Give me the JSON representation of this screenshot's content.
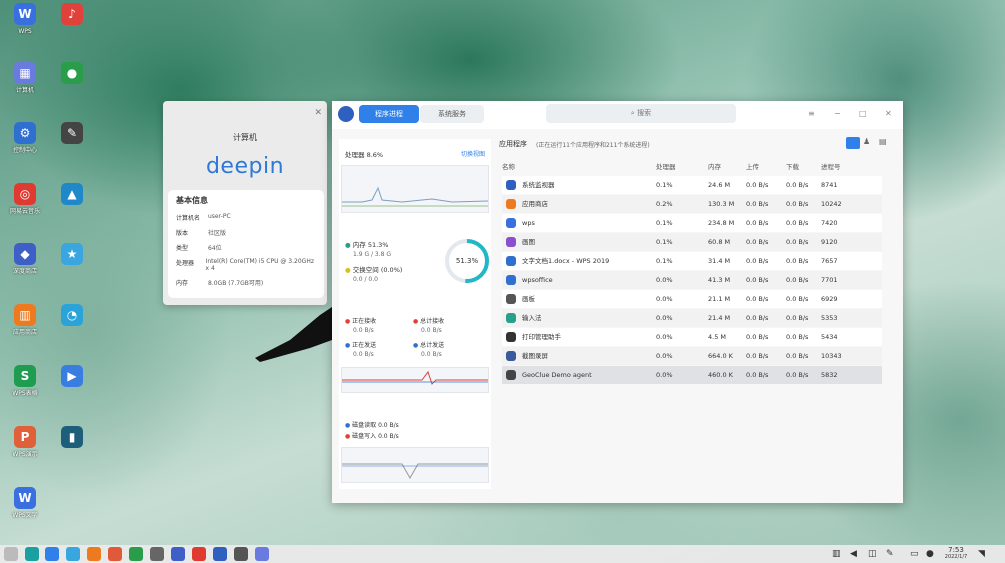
{
  "desktop": {
    "icons": [
      {
        "label": "WPS",
        "glyph": "W",
        "color": "#3a6fe0"
      },
      {
        "label": "",
        "glyph": "♪",
        "color": "#e0413a"
      },
      {
        "label": "计算机",
        "glyph": "▦",
        "color": "#6a7be0"
      },
      {
        "label": "",
        "glyph": "●",
        "color": "#2a9d4b"
      },
      {
        "label": "控制中心",
        "glyph": "⚙",
        "color": "#2f6fd0"
      },
      {
        "label": "",
        "glyph": "✎",
        "color": "#444"
      },
      {
        "label": "网易云音乐",
        "glyph": "◎",
        "color": "#e03a30"
      },
      {
        "label": "",
        "glyph": "▲",
        "color": "#1e88c9"
      },
      {
        "label": "深度商店",
        "glyph": "◆",
        "color": "#3f5fc8"
      },
      {
        "label": "",
        "glyph": "★",
        "color": "#3aa6e0"
      },
      {
        "label": "应用商店",
        "glyph": "▥",
        "color": "#ee7a20"
      },
      {
        "label": "",
        "glyph": "◔",
        "color": "#2aa3d8"
      },
      {
        "label": "WPS表格",
        "glyph": "S",
        "color": "#1e9d50"
      },
      {
        "label": "",
        "glyph": "▶",
        "color": "#3a7de0"
      },
      {
        "label": "WPS演示",
        "glyph": "P",
        "color": "#e0603a"
      },
      {
        "label": "",
        "glyph": "▮",
        "color": "#1d5f7a"
      },
      {
        "label": "WPS文字",
        "glyph": "W",
        "color": "#3a6fe0"
      }
    ]
  },
  "about": {
    "title": "计算机",
    "logo": "deepin",
    "section": "基本信息",
    "rows": [
      {
        "k": "计算机名",
        "v": "user-PC"
      },
      {
        "k": "版本",
        "v": "社区版"
      },
      {
        "k": "类型",
        "v": "64位"
      },
      {
        "k": "处理器",
        "v": "Intel(R) Core(TM) i5 CPU @ 3.20GHz x 4"
      },
      {
        "k": "内存",
        "v": "8.0GB (7.7GB可用)"
      }
    ]
  },
  "monitor": {
    "tabs": [
      "程序进程",
      "系统服务"
    ],
    "search_placeholder": "搜索",
    "left": {
      "cpu_title": "处理器 8.6%",
      "cpu_link": "切换视图",
      "mem_label": "内存 51.3%",
      "mem_detail": "1.9 G / 3.8 G",
      "swap_label": "交换空间 (0.0%)",
      "swap_detail": "0.0 / 0.0",
      "mem_percent": "51.3%",
      "mem_fraction": 0.513,
      "net": [
        {
          "label": "正在接收",
          "value": "0.0 B/s",
          "color": "#e0403a"
        },
        {
          "label": "总计接收",
          "value": "0.0 B/s",
          "color": "#e0403a"
        },
        {
          "label": "正在发送",
          "value": "0.0 B/s",
          "color": "#2f6fd0"
        },
        {
          "label": "总计发送",
          "value": "0.0 B/s",
          "color": "#2f6fd0"
        }
      ],
      "disk_read": "磁盘读取 0.0 B/s",
      "disk_write": "磁盘写入 0.0 B/s"
    },
    "right": {
      "title": "应用程序",
      "subtitle": "(正在运行11个应用程序和211个系统进程)",
      "columns": [
        "名称",
        "处理器",
        "内存",
        "上传",
        "下载",
        "进程号"
      ],
      "rows": [
        {
          "name": "系统监视器",
          "cpu": "0.1%",
          "mem": "24.6 M",
          "up": "0.0 B/s",
          "down": "0.0 B/s",
          "pid": "8741",
          "color": "#2f5fbf"
        },
        {
          "name": "应用商店",
          "cpu": "0.2%",
          "mem": "130.3 M",
          "up": "0.0 B/s",
          "down": "0.0 B/s",
          "pid": "10242",
          "color": "#ee7a20"
        },
        {
          "name": "wps",
          "cpu": "0.1%",
          "mem": "234.8 M",
          "up": "0.0 B/s",
          "down": "0.0 B/s",
          "pid": "7420",
          "color": "#3a6fe0"
        },
        {
          "name": "画图",
          "cpu": "0.1%",
          "mem": "60.8 M",
          "up": "0.0 B/s",
          "down": "0.0 B/s",
          "pid": "9120",
          "color": "#8a4fd0"
        },
        {
          "name": "文字文档1.docx - WPS 2019",
          "cpu": "0.1%",
          "mem": "31.4 M",
          "up": "0.0 B/s",
          "down": "0.0 B/s",
          "pid": "7657",
          "color": "#2f6fd0"
        },
        {
          "name": "wpsoffice",
          "cpu": "0.0%",
          "mem": "41.3 M",
          "up": "0.0 B/s",
          "down": "0.0 B/s",
          "pid": "7701",
          "color": "#2f6fd0"
        },
        {
          "name": "画板",
          "cpu": "0.0%",
          "mem": "21.1 M",
          "up": "0.0 B/s",
          "down": "0.0 B/s",
          "pid": "6929",
          "color": "#555"
        },
        {
          "name": "输入法",
          "cpu": "0.0%",
          "mem": "21.4 M",
          "up": "0.0 B/s",
          "down": "0.0 B/s",
          "pid": "5353",
          "color": "#2aa08a"
        },
        {
          "name": "打印管理助手",
          "cpu": "0.0%",
          "mem": "4.5 M",
          "up": "0.0 B/s",
          "down": "0.0 B/s",
          "pid": "5434",
          "color": "#333"
        },
        {
          "name": "截图录屏",
          "cpu": "0.0%",
          "mem": "664.0 K",
          "up": "0.0 B/s",
          "down": "0.0 B/s",
          "pid": "10343",
          "color": "#3a5a9a"
        },
        {
          "name": "GeoClue Demo agent",
          "cpu": "0.0%",
          "mem": "460.0 K",
          "up": "0.0 B/s",
          "down": "0.0 B/s",
          "pid": "5832",
          "color": "#444"
        }
      ]
    }
  },
  "taskbar": {
    "time": "7:53",
    "date": "2022/1/7"
  }
}
